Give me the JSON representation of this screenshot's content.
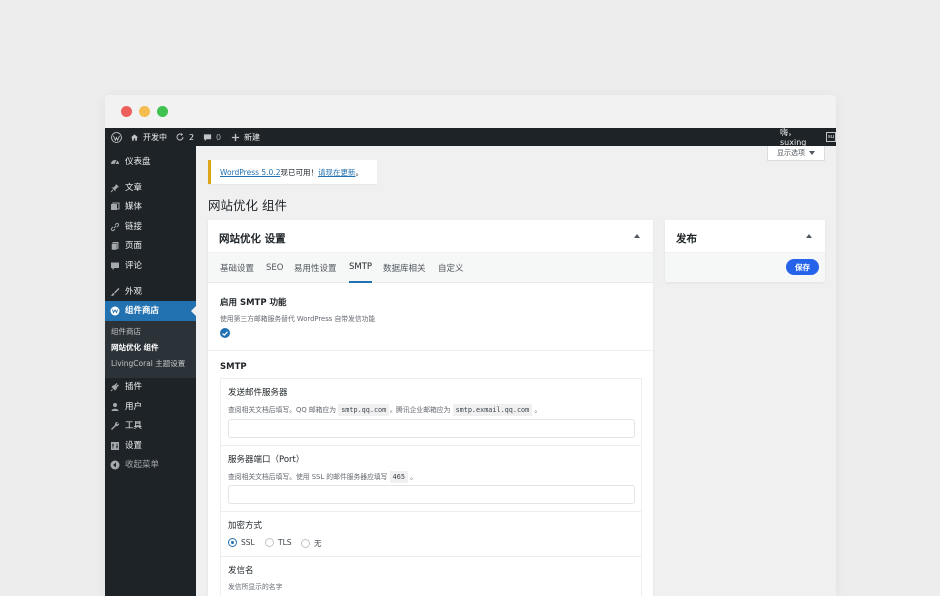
{
  "adminbar": {
    "site_name": "开发中",
    "updates_count": "2",
    "comments_count": "0",
    "new_label": "新建",
    "greeting": "嗨，suxing",
    "avatar_text": "su"
  },
  "sidebar": {
    "items": [
      {
        "label": "仪表盘",
        "icon": "dashboard-icon"
      },
      {
        "label": "文章",
        "icon": "pin-icon"
      },
      {
        "label": "媒体",
        "icon": "media-icon"
      },
      {
        "label": "链接",
        "icon": "link-icon"
      },
      {
        "label": "页面",
        "icon": "page-icon"
      },
      {
        "label": "评论",
        "icon": "comment-icon"
      },
      {
        "label": "外观",
        "icon": "brush-icon"
      },
      {
        "label": "组件商店",
        "icon": "store-icon"
      },
      {
        "label": "插件",
        "icon": "plugin-icon"
      },
      {
        "label": "用户",
        "icon": "user-icon"
      },
      {
        "label": "工具",
        "icon": "wrench-icon"
      },
      {
        "label": "设置",
        "icon": "settings-icon"
      },
      {
        "label": "收起菜单",
        "icon": "collapse-icon"
      }
    ],
    "submenu": [
      {
        "label": "组件商店"
      },
      {
        "label": "网站优化 组件"
      },
      {
        "label": "LivingCoral 主题设置"
      }
    ]
  },
  "screen_options": {
    "label": "显示选项"
  },
  "notice": {
    "version_link": "WordPress 5.0.2",
    "text_mid": "现已可用！",
    "update_link": "请现在更新",
    "text_end": "。"
  },
  "page": {
    "title": "网站优化 组件"
  },
  "settings_panel": {
    "title": "网站优化 设置",
    "tabs": [
      "基础设置",
      "SEO",
      "易用性设置",
      "SMTP",
      "数据库相关",
      "自定义"
    ],
    "active_tab": "SMTP",
    "smtp_enable": {
      "title": "启用 SMTP 功能",
      "desc": "使用第三方邮箱服务替代 WordPress 自带发信功能",
      "checked": true
    },
    "smtp_section": "SMTP",
    "server": {
      "label": "发送邮件服务器",
      "desc_1": "查阅相关文档后填写。QQ 邮箱应为",
      "code_1": "smtp.qq.com",
      "desc_2": "，腾讯企业邮箱应为",
      "code_2": "smtp.exmail.qq.com",
      "desc_3": "。",
      "value": ""
    },
    "port": {
      "label": "服务器端口（Port）",
      "desc_1": "查阅相关文档后填写。使用 SSL 的邮件服务器应填写",
      "code_1": "465",
      "desc_2": "。",
      "value": ""
    },
    "encryption": {
      "label": "加密方式",
      "options": [
        "SSL",
        "TLS",
        "无"
      ],
      "selected": "SSL"
    },
    "sender": {
      "label": "发信名",
      "desc": "发信所显示的名字"
    }
  },
  "publish_panel": {
    "title": "发布",
    "save_label": "保存"
  },
  "colors": {
    "accent": "#2271b1",
    "save_button": "#2563eb",
    "adminbar": "#1d2327",
    "notice_warning": "#dba617"
  }
}
